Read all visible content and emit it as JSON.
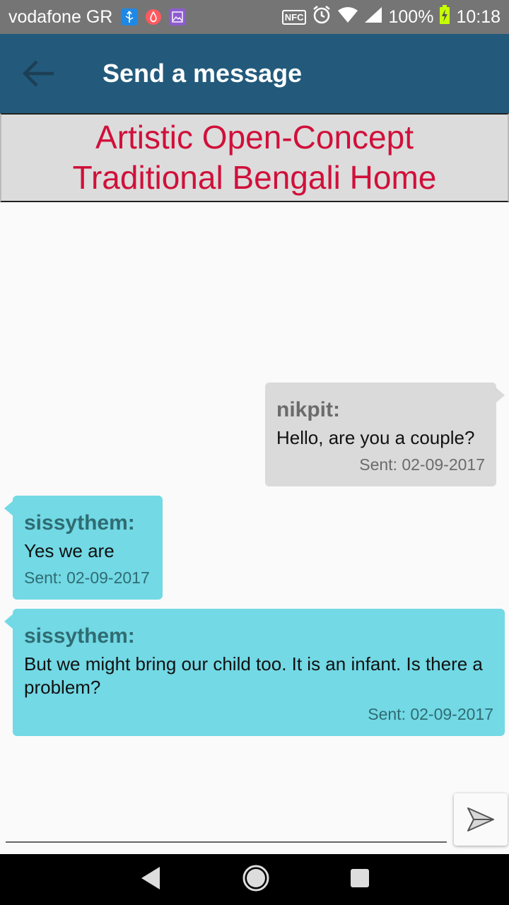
{
  "status_bar": {
    "carrier": "vodafone GR",
    "nfc": "NFC",
    "battery": "100%",
    "time": "10:18"
  },
  "app_bar": {
    "title": "Send a message"
  },
  "listing": {
    "title": "Artistic Open-Concept Traditional Bengali Home"
  },
  "messages": [
    {
      "sender": "nikpit:",
      "text": "Hello, are you a couple?",
      "sent": "Sent: 02-09-2017"
    },
    {
      "sender": "sissythem:",
      "text": "Yes we are",
      "sent": "Sent: 02-09-2017"
    },
    {
      "sender": "sissythem:",
      "text": "But we might bring our child too. It is an infant. Is there a problem?",
      "sent": "Sent: 02-09-2017"
    }
  ],
  "composer": {
    "placeholder": ""
  },
  "colors": {
    "status_bar": "#757575",
    "app_bar": "#235a7b",
    "listing_title": "#d0103a",
    "outgoing_bubble": "#dadada",
    "incoming_bubble": "#72d9e5"
  }
}
